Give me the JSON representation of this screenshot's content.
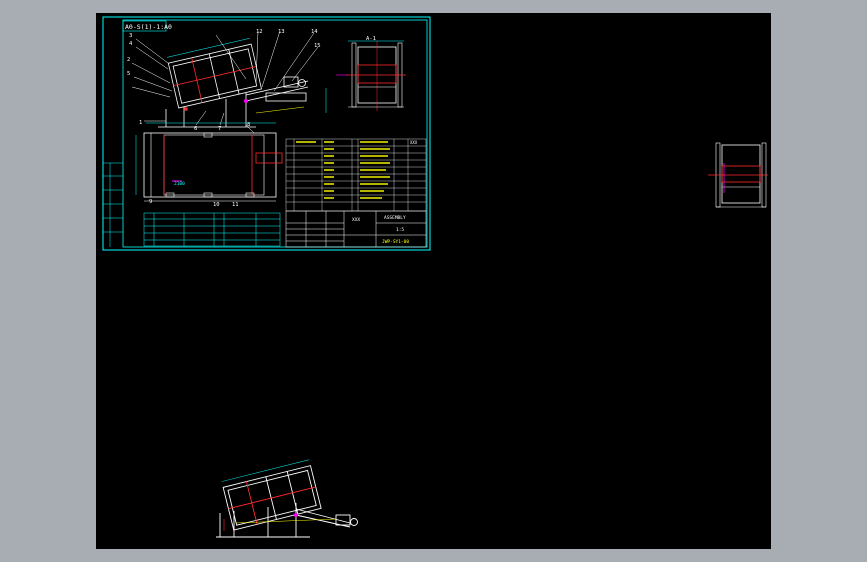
{
  "application": {
    "name": "CAD drawing viewer",
    "background": "#000000",
    "frame_color": "#a8acb3"
  },
  "colors": {
    "border": "#00ffff",
    "line_white": "#ffffff",
    "accent_red": "#ff2a2a",
    "accent_magenta": "#ff00ff",
    "accent_yellow": "#ffff00",
    "accent_green": "#00ff00"
  },
  "sheet": {
    "view_title": "A0-S(1)-1:A0",
    "section_label": "A-1",
    "balloons": [
      "3",
      "4",
      "2",
      "5",
      "1",
      "6",
      "7",
      "8",
      "9",
      "10",
      "11",
      "12",
      "13",
      "14",
      "15"
    ],
    "dimension_label": "2100",
    "table_header": "XXX",
    "title_block": {
      "code": "ASSEMBLY",
      "scale": "1:5",
      "drawing_no": "JWP-SY1-00",
      "designer": "XXX"
    }
  }
}
